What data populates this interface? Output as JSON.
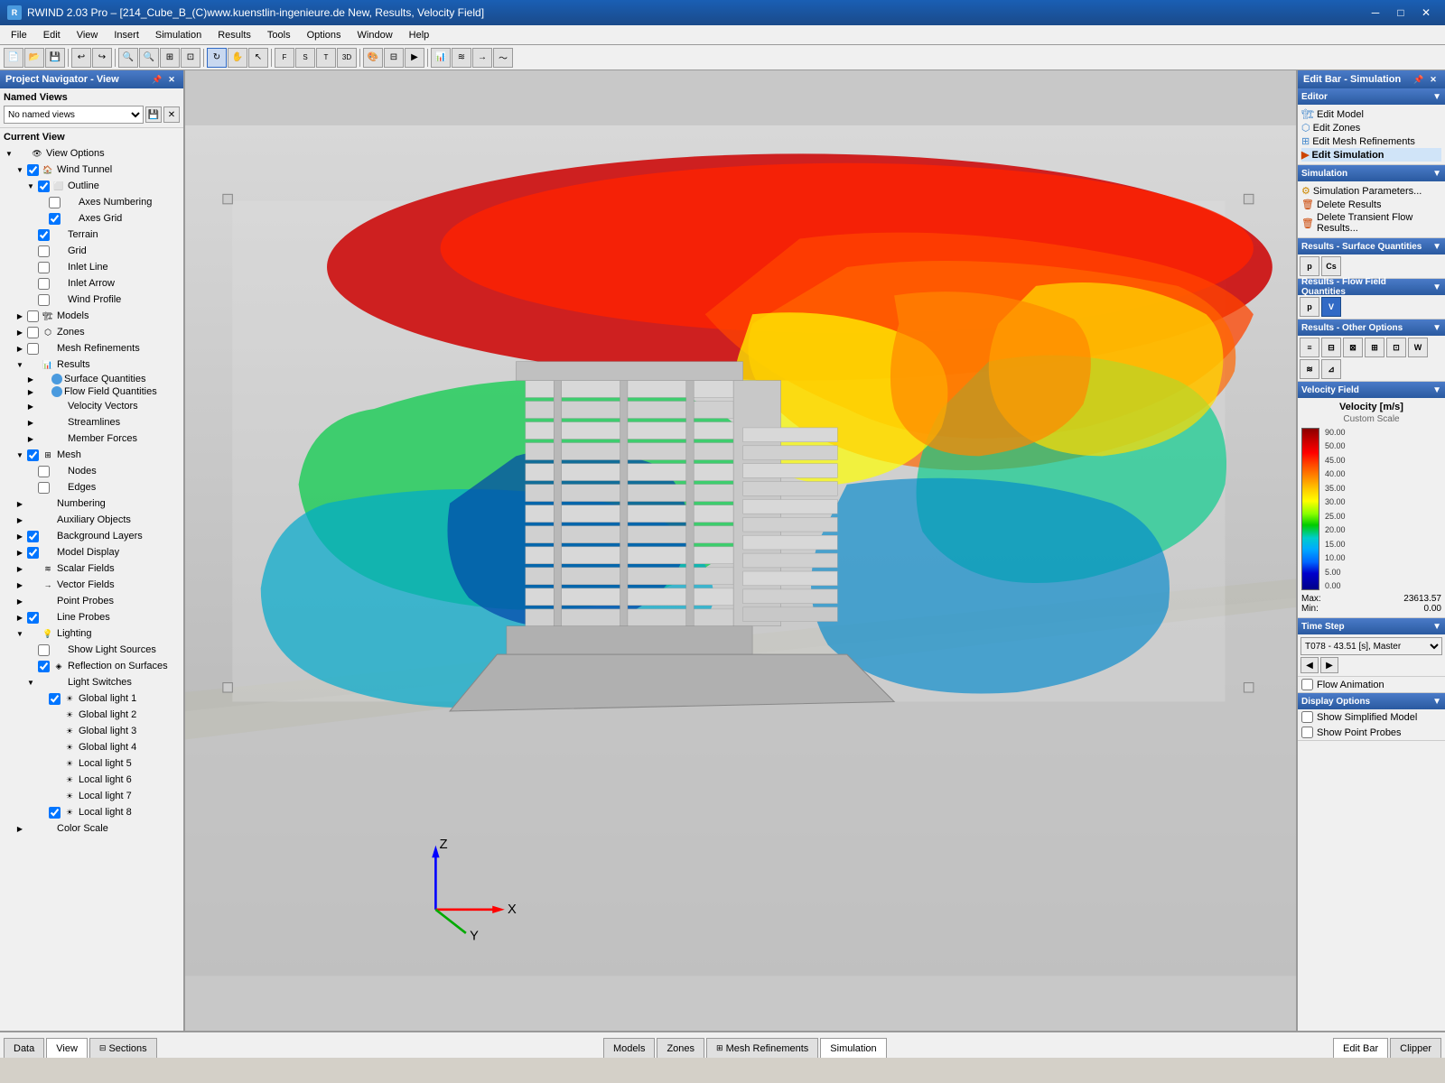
{
  "window": {
    "title": "RWIND 2.03 Pro – [214_Cube_B_(C)www.kuenstlin-ingenieure.de New, Results, Velocity Field]",
    "icon": "R"
  },
  "menu": {
    "items": [
      "File",
      "Edit",
      "View",
      "Insert",
      "Simulation",
      "Results",
      "Tools",
      "Options",
      "Window",
      "Help"
    ]
  },
  "left_panel": {
    "title": "Project Navigator - View",
    "named_views_label": "Named Views",
    "named_views_placeholder": "No named views",
    "current_view_label": "Current View",
    "tree": [
      {
        "id": "view-options",
        "label": "View Options",
        "indent": 0,
        "has_toggle": true,
        "toggle_state": "expanded",
        "has_checkbox": false
      },
      {
        "id": "wind-tunnel",
        "label": "Wind Tunnel",
        "indent": 1,
        "has_toggle": true,
        "toggle_state": "expanded",
        "has_checkbox": true,
        "checked": true
      },
      {
        "id": "outline",
        "label": "Outline",
        "indent": 2,
        "has_toggle": true,
        "toggle_state": "expanded",
        "has_checkbox": true,
        "checked": true
      },
      {
        "id": "axes-numbering",
        "label": "Axes Numbering",
        "indent": 3,
        "has_toggle": false,
        "has_checkbox": true,
        "checked": false
      },
      {
        "id": "axes-grid",
        "label": "Axes Grid",
        "indent": 3,
        "has_toggle": false,
        "has_checkbox": true,
        "checked": true
      },
      {
        "id": "terrain",
        "label": "Terrain",
        "indent": 2,
        "has_toggle": false,
        "has_checkbox": true,
        "checked": true
      },
      {
        "id": "grid",
        "label": "Grid",
        "indent": 2,
        "has_toggle": false,
        "has_checkbox": true,
        "checked": false
      },
      {
        "id": "inlet-line",
        "label": "Inlet Line",
        "indent": 2,
        "has_toggle": false,
        "has_checkbox": true,
        "checked": false
      },
      {
        "id": "inlet-arrow",
        "label": "Inlet Arrow",
        "indent": 2,
        "has_toggle": false,
        "has_checkbox": true,
        "checked": false
      },
      {
        "id": "wind-profile",
        "label": "Wind Profile",
        "indent": 2,
        "has_toggle": false,
        "has_checkbox": true,
        "checked": false
      },
      {
        "id": "models",
        "label": "Models",
        "indent": 1,
        "has_toggle": true,
        "toggle_state": "collapsed",
        "has_checkbox": true,
        "checked": false
      },
      {
        "id": "zones",
        "label": "Zones",
        "indent": 1,
        "has_toggle": true,
        "toggle_state": "collapsed",
        "has_checkbox": true,
        "checked": false
      },
      {
        "id": "mesh-refinements",
        "label": "Mesh Refinements",
        "indent": 1,
        "has_toggle": true,
        "toggle_state": "collapsed",
        "has_checkbox": true,
        "checked": false
      },
      {
        "id": "results",
        "label": "Results",
        "indent": 1,
        "has_toggle": true,
        "toggle_state": "expanded",
        "has_checkbox": false
      },
      {
        "id": "surface-quantities",
        "label": "Surface Quantities",
        "indent": 2,
        "has_toggle": true,
        "toggle_state": "collapsed",
        "has_checkbox": false
      },
      {
        "id": "flow-field-quantities",
        "label": "Flow Field Quantities",
        "indent": 2,
        "has_toggle": true,
        "toggle_state": "collapsed",
        "has_checkbox": false
      },
      {
        "id": "velocity-vectors",
        "label": "Velocity Vectors",
        "indent": 2,
        "has_toggle": true,
        "toggle_state": "collapsed",
        "has_checkbox": false
      },
      {
        "id": "streamlines",
        "label": "Streamlines",
        "indent": 2,
        "has_toggle": true,
        "toggle_state": "collapsed",
        "has_checkbox": false
      },
      {
        "id": "member-forces",
        "label": "Member Forces",
        "indent": 2,
        "has_toggle": true,
        "toggle_state": "collapsed",
        "has_checkbox": false
      },
      {
        "id": "mesh",
        "label": "Mesh",
        "indent": 1,
        "has_toggle": true,
        "toggle_state": "expanded",
        "has_checkbox": true,
        "checked": true
      },
      {
        "id": "nodes",
        "label": "Nodes",
        "indent": 2,
        "has_toggle": false,
        "has_checkbox": true,
        "checked": false
      },
      {
        "id": "edges",
        "label": "Edges",
        "indent": 2,
        "has_toggle": false,
        "has_checkbox": true,
        "checked": false
      },
      {
        "id": "numbering",
        "label": "Numbering",
        "indent": 1,
        "has_toggle": true,
        "toggle_state": "collapsed",
        "has_checkbox": false
      },
      {
        "id": "auxiliary-objects",
        "label": "Auxiliary Objects",
        "indent": 1,
        "has_toggle": true,
        "toggle_state": "collapsed",
        "has_checkbox": false
      },
      {
        "id": "background-layers",
        "label": "Background Layers",
        "indent": 1,
        "has_toggle": true,
        "toggle_state": "collapsed",
        "has_checkbox": true,
        "checked": true
      },
      {
        "id": "model-display",
        "label": "Model Display",
        "indent": 1,
        "has_toggle": true,
        "toggle_state": "collapsed",
        "has_checkbox": true,
        "checked": true
      },
      {
        "id": "scalar-fields",
        "label": "Scalar Fields",
        "indent": 1,
        "has_toggle": true,
        "toggle_state": "collapsed",
        "has_checkbox": false
      },
      {
        "id": "vector-fields",
        "label": "Vector Fields",
        "indent": 1,
        "has_toggle": true,
        "toggle_state": "collapsed",
        "has_checkbox": false
      },
      {
        "id": "point-probes",
        "label": "Point Probes",
        "indent": 1,
        "has_toggle": true,
        "toggle_state": "collapsed",
        "has_checkbox": false
      },
      {
        "id": "line-probes",
        "label": "Line Probes",
        "indent": 1,
        "has_toggle": true,
        "toggle_state": "collapsed",
        "has_checkbox": true,
        "checked": true
      },
      {
        "id": "lighting",
        "label": "Lighting",
        "indent": 1,
        "has_toggle": true,
        "toggle_state": "expanded",
        "has_checkbox": false
      },
      {
        "id": "show-light-sources",
        "label": "Show Light Sources",
        "indent": 2,
        "has_toggle": false,
        "has_checkbox": true,
        "checked": false
      },
      {
        "id": "reflection-on-surfaces",
        "label": "Reflection on Surfaces",
        "indent": 2,
        "has_toggle": false,
        "has_checkbox": true,
        "checked": true
      },
      {
        "id": "light-switches",
        "label": "Light Switches",
        "indent": 2,
        "has_toggle": true,
        "toggle_state": "expanded",
        "has_checkbox": false
      },
      {
        "id": "global-light-1",
        "label": "Global light 1",
        "indent": 3,
        "has_toggle": false,
        "has_checkbox": true,
        "checked": true
      },
      {
        "id": "global-light-2",
        "label": "Global light 2",
        "indent": 3,
        "has_toggle": false,
        "has_checkbox": false,
        "checked": false
      },
      {
        "id": "global-light-3",
        "label": "Global light 3",
        "indent": 3,
        "has_toggle": false,
        "has_checkbox": false,
        "checked": false
      },
      {
        "id": "global-light-4",
        "label": "Global light 4",
        "indent": 3,
        "has_toggle": false,
        "has_checkbox": false,
        "checked": false
      },
      {
        "id": "local-light-5",
        "label": "Local light 5",
        "indent": 3,
        "has_toggle": false,
        "has_checkbox": false,
        "checked": false
      },
      {
        "id": "local-light-6",
        "label": "Local light 6",
        "indent": 3,
        "has_toggle": false,
        "has_checkbox": false,
        "checked": false
      },
      {
        "id": "local-light-7",
        "label": "Local light 7",
        "indent": 3,
        "has_toggle": false,
        "has_checkbox": false,
        "checked": false
      },
      {
        "id": "local-light-8",
        "label": "Local light 8",
        "indent": 3,
        "has_toggle": false,
        "has_checkbox": true,
        "checked": true
      },
      {
        "id": "color-scale",
        "label": "Color Scale",
        "indent": 1,
        "has_toggle": true,
        "toggle_state": "collapsed",
        "has_checkbox": false
      }
    ]
  },
  "right_panel": {
    "title": "Edit Bar - Simulation",
    "sections": {
      "editor": {
        "title": "Editor",
        "items": [
          "Edit Model",
          "Edit Zones",
          "Edit Mesh Refinements",
          "Edit Simulation"
        ]
      },
      "simulation": {
        "title": "Simulation",
        "items": [
          "Simulation Parameters...",
          "Delete Results",
          "Delete Transient Flow Results..."
        ]
      },
      "results_surface": {
        "title": "Results - Surface Quantities",
        "buttons": [
          "p",
          "Cs"
        ]
      },
      "results_flow": {
        "title": "Results - Flow Field Quantities",
        "buttons": [
          "p",
          "V"
        ],
        "active": "V"
      },
      "results_other": {
        "title": "Results - Other Options",
        "buttons": [
          "icon1",
          "icon2",
          "icon3",
          "icon4",
          "icon5",
          "icon6",
          "icon7",
          "icon8"
        ]
      }
    },
    "velocity_field": {
      "title": "Velocity Field",
      "unit": "Velocity [m/s]",
      "scale_type": "Custom Scale",
      "scale_values": [
        "90.00",
        "50.00",
        "45.00",
        "40.00",
        "35.00",
        "30.00",
        "25.00",
        "20.00",
        "15.00",
        "10.00",
        "5.00",
        "0.00"
      ],
      "max_label": "Max:",
      "max_value": "23613.57",
      "min_label": "Min:",
      "min_value": "0.00"
    },
    "time_step": {
      "title": "Time Step",
      "current": "T078 - 43.51 [s], Master"
    },
    "flow_animation": {
      "label": "Flow Animation",
      "checked": false
    },
    "display_options": {
      "title": "Display Options",
      "show_simplified_model": {
        "label": "Show Simplified Model",
        "checked": false
      },
      "show_point_probes": {
        "label": "Show Point Probes",
        "checked": false
      }
    }
  },
  "bottom_tabs": {
    "left": [
      {
        "id": "data-tab",
        "label": "Data",
        "active": false
      },
      {
        "id": "view-tab",
        "label": "View",
        "active": true
      },
      {
        "id": "sections-tab",
        "label": "Sections",
        "active": false
      }
    ],
    "center": [
      {
        "id": "models-tab",
        "label": "Models",
        "active": false
      },
      {
        "id": "zones-tab",
        "label": "Zones",
        "active": false
      },
      {
        "id": "mesh-refinements-tab",
        "label": "Mesh Refinements",
        "active": false
      },
      {
        "id": "simulation-tab",
        "label": "Simulation",
        "active": true
      }
    ],
    "right": [
      {
        "id": "edit-bar-tab",
        "label": "Edit Bar",
        "active": true
      },
      {
        "id": "clipper-tab",
        "label": "Clipper",
        "active": false
      }
    ]
  },
  "viewport": {
    "axis_labels": {
      "x": "X",
      "y": "Y",
      "z": "Z"
    }
  },
  "colors": {
    "accent": "#316ac5",
    "panel_header": "#2a5aa0",
    "active_tab": "#ffffff",
    "velocity_colors": {
      "c90": "#8b0000",
      "c50": "#cc0000",
      "c45": "#ff2200",
      "c40": "#ff6600",
      "c35": "#ffaa00",
      "c30": "#ffcc00",
      "c25": "#ffff00",
      "c20": "#aaff00",
      "c15": "#00cc44",
      "c10": "#00aacc",
      "c5": "#0055ff",
      "c0": "#000088"
    }
  }
}
